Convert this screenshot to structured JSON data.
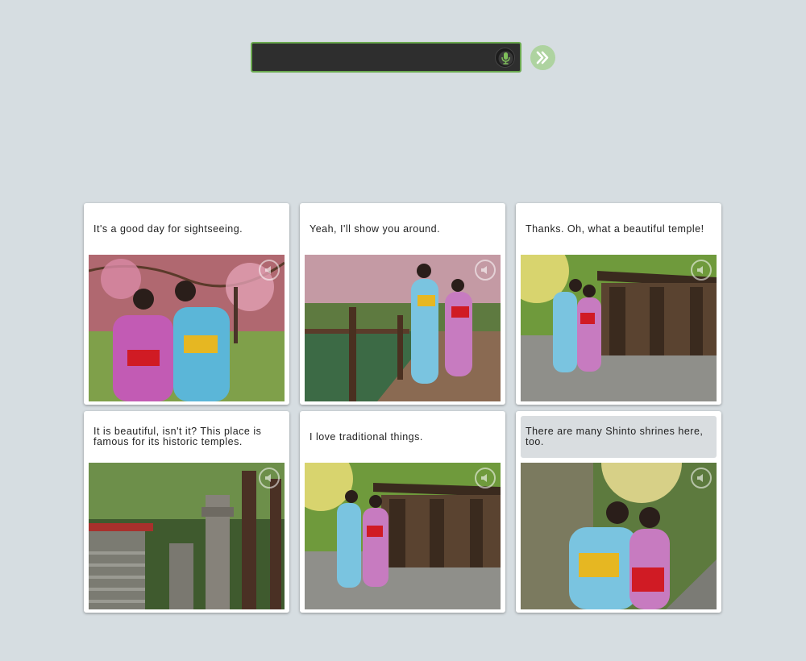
{
  "search": {
    "value": ""
  },
  "cards": [
    {
      "text": "It's a good day for sightseeing."
    },
    {
      "text": "Yeah, I'll show you around."
    },
    {
      "text": "Thanks. Oh, what a beautiful temple!"
    },
    {
      "text": "It is beautiful, isn't it? This place is famous for its historic temples."
    },
    {
      "text": "I love traditional things."
    },
    {
      "text": "There are many Shinto shrines here, too."
    }
  ],
  "colors": {
    "background": "#d6dde1",
    "input_border": "#6aa84f",
    "next_button": "#aed3a0",
    "selected_text_bg": "#d9dde0"
  },
  "icons": {
    "mic": "microphone-icon",
    "next": "double-chevron-right-icon",
    "speaker": "speaker-icon"
  }
}
